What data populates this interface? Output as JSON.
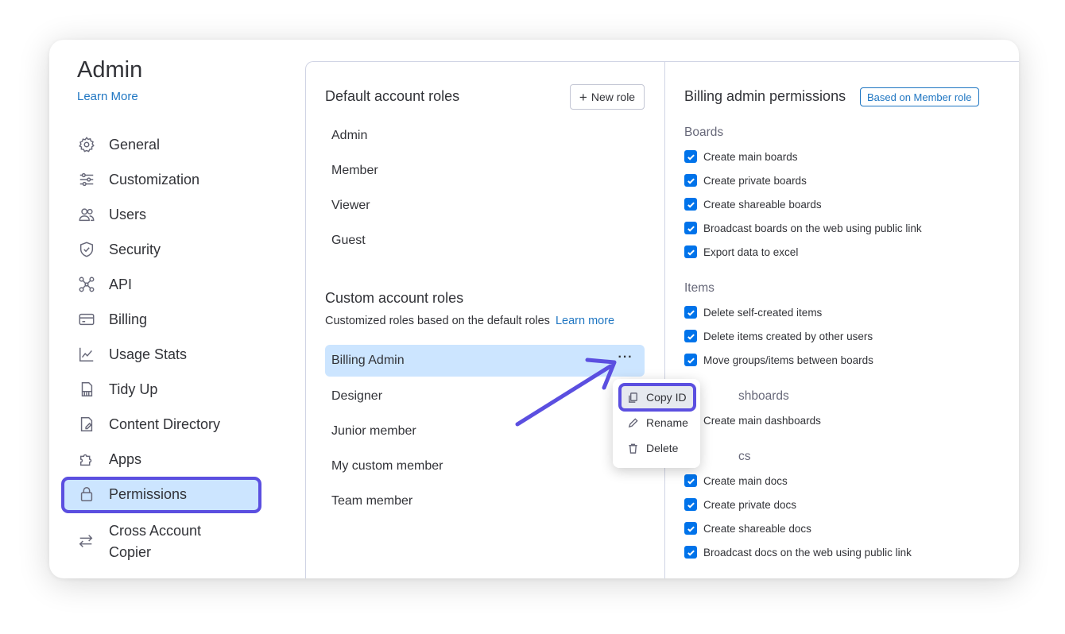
{
  "sidebar": {
    "title": "Admin",
    "learn_more": "Learn More",
    "items": [
      {
        "label": "General",
        "icon": "gear-icon"
      },
      {
        "label": "Customization",
        "icon": "sliders-icon"
      },
      {
        "label": "Users",
        "icon": "users-icon"
      },
      {
        "label": "Security",
        "icon": "shield-icon"
      },
      {
        "label": "API",
        "icon": "api-icon"
      },
      {
        "label": "Billing",
        "icon": "credit-card-icon"
      },
      {
        "label": "Usage Stats",
        "icon": "chart-icon"
      },
      {
        "label": "Tidy Up",
        "icon": "tidy-icon"
      },
      {
        "label": "Content Directory",
        "icon": "document-icon"
      },
      {
        "label": "Apps",
        "icon": "puzzle-icon"
      },
      {
        "label": "Permissions",
        "icon": "lock-icon",
        "selected": true
      },
      {
        "label": "Cross Account Copier",
        "icon": "transfer-icon"
      }
    ]
  },
  "roles": {
    "default_title": "Default account roles",
    "new_role_label": "New role",
    "default_roles": [
      "Admin",
      "Member",
      "Viewer",
      "Guest"
    ],
    "custom_title": "Custom account roles",
    "custom_subtitle": "Customized roles based on the default roles",
    "custom_learn_more": "Learn more",
    "custom_roles": [
      "Billing Admin",
      "Designer",
      "Junior member",
      "My custom member",
      "Team member"
    ],
    "selected_role": "Billing Admin"
  },
  "context_menu": {
    "items": [
      {
        "label": "Copy ID",
        "icon": "copy-icon"
      },
      {
        "label": "Rename",
        "icon": "pencil-icon"
      },
      {
        "label": "Delete",
        "icon": "trash-icon"
      }
    ]
  },
  "permissions": {
    "title": "Billing admin permissions",
    "badge": "Based on Member role",
    "groups": [
      {
        "name": "Boards",
        "items": [
          "Create main boards",
          "Create private boards",
          "Create shareable boards",
          "Broadcast boards on the web using public link",
          "Export data to excel"
        ]
      },
      {
        "name": "Items",
        "items": [
          "Delete self-created items",
          "Delete items created by other users",
          "Move groups/items between boards"
        ]
      },
      {
        "name": "shboards",
        "items": [
          "Create main dashboards"
        ]
      },
      {
        "name": "cs",
        "items": [
          "Create main docs",
          "Create private docs",
          "Create shareable docs",
          "Broadcast docs on the web using public link"
        ]
      }
    ]
  },
  "colors": {
    "accent": "#0073ea",
    "highlight": "#5b4fe0",
    "selected_bg": "#cce5ff",
    "link": "#1f76c2"
  }
}
